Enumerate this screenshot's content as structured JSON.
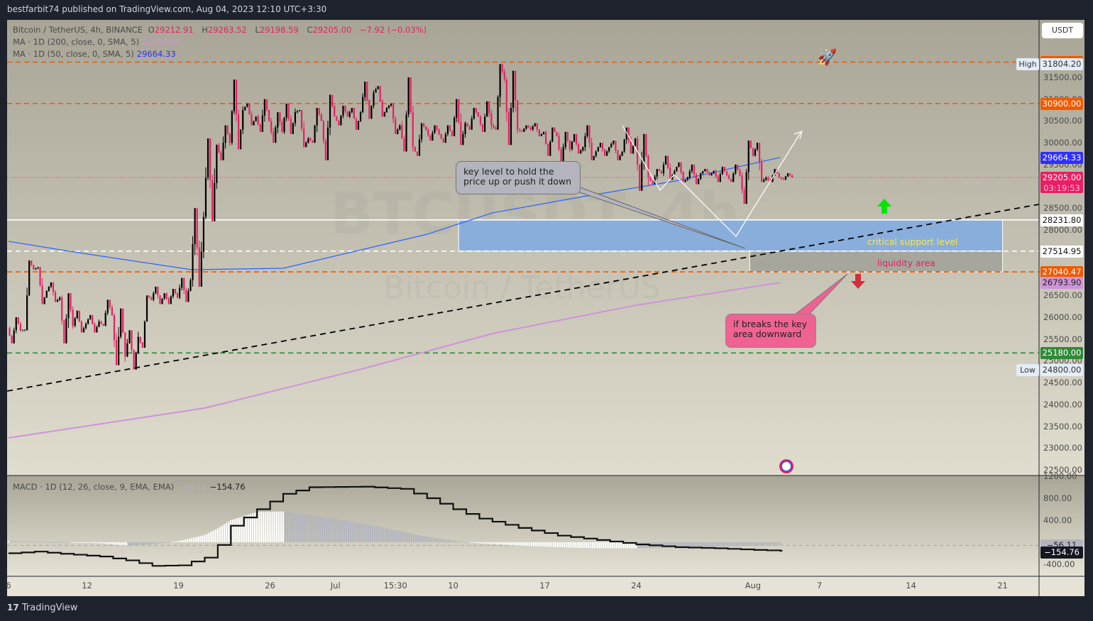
{
  "header": {
    "published": "bestfarbit74 published on TradingView.com, Aug 04, 2023 12:10 UTC+3:30"
  },
  "legend": {
    "symbol": "Bitcoin / TetherUS, 4h, BINANCE",
    "o_label": "O",
    "o": "29212.91",
    "h_label": "H",
    "h": "29263.52",
    "l_label": "L",
    "l": "29198.59",
    "c_label": "C",
    "c": "29205.00",
    "change": "−7.92 (−0.03%)",
    "ma200_label": "MA · 1D (200, close, 0, SMA, 5)",
    "ma200_value": "26793.90",
    "ma50_label": "MA · 1D (50, close, 0, SMA, 5)",
    "ma50_value": "29664.33",
    "macd_label": "MACD · 1D (12, 26, close, 9, EMA, EMA)",
    "macd_hist_value": "−56.11",
    "macd_value": "−154.76"
  },
  "watermark": {
    "line1": "BTCUSDT, 4h",
    "line2": "Bitcoin / TetherUS"
  },
  "currency": "USDT",
  "footer": {
    "brand": "TradingView"
  },
  "annotations": {
    "key_level": "key level to hold the price up or push it down",
    "breaks": "if breaks the key area downward",
    "critical": "critical support level",
    "liquidity": "liquidity area"
  },
  "colors": {
    "up": "#000000",
    "down": "#e91e63",
    "ma50": "#2962ff",
    "ma200": "#ce93d8",
    "orange": "#f05a00",
    "green": "#2e8b36",
    "zone_blue": "#8aaedc",
    "zone_grey": "#a7a69c"
  },
  "chart_data": {
    "type": "candlestick",
    "symbol": "BTCUSDT",
    "interval": "4h",
    "ylim": [
      22500,
      32000
    ],
    "price_ticks": [
      22500,
      23000,
      23500,
      24000,
      24500,
      25000,
      25500,
      26000,
      26500,
      27000,
      27500,
      28000,
      28500,
      29000,
      29500,
      30000,
      30500,
      31000,
      31500
    ],
    "time_ticks": [
      {
        "label": "6",
        "date": "2023-06-06"
      },
      {
        "label": "12",
        "date": "2023-06-12"
      },
      {
        "label": "19",
        "date": "2023-06-19"
      },
      {
        "label": "26",
        "date": "2023-06-26"
      },
      {
        "label": "Jul",
        "date": "2023-07-01"
      },
      {
        "label": "15:30",
        "date": "2023-07-05T14:00"
      },
      {
        "label": "10",
        "date": "2023-07-10"
      },
      {
        "label": "17",
        "date": "2023-07-17"
      },
      {
        "label": "24",
        "date": "2023-07-24"
      },
      {
        "label": "Aug",
        "date": "2023-08-01T22:00"
      },
      {
        "label": "7",
        "date": "2023-08-07"
      },
      {
        "label": "14",
        "date": "2023-08-14"
      },
      {
        "label": "21",
        "date": "2023-08-21"
      }
    ],
    "daily_ohlc": [
      [
        "2023-06-06",
        25750,
        26000,
        25400,
        25700
      ],
      [
        "2023-06-07",
        25700,
        27300,
        25700,
        27100
      ],
      [
        "2023-06-08",
        27100,
        27150,
        26300,
        26600
      ],
      [
        "2023-06-09",
        26600,
        26800,
        26350,
        26450
      ],
      [
        "2023-06-10",
        26450,
        26550,
        25400,
        25800
      ],
      [
        "2023-06-11",
        25800,
        26150,
        25650,
        25850
      ],
      [
        "2023-06-12",
        25850,
        26050,
        25650,
        25900
      ],
      [
        "2023-06-13",
        25900,
        26400,
        25800,
        26050
      ],
      [
        "2023-06-14",
        26050,
        26200,
        24900,
        25100
      ],
      [
        "2023-06-15",
        25100,
        25700,
        24800,
        25550
      ],
      [
        "2023-06-16",
        25550,
        26500,
        25300,
        26400
      ],
      [
        "2023-06-17",
        26400,
        26700,
        26300,
        26550
      ],
      [
        "2023-06-18",
        26550,
        26650,
        26300,
        26450
      ],
      [
        "2023-06-19",
        26450,
        26900,
        26350,
        26850
      ],
      [
        "2023-06-20",
        26850,
        28500,
        26700,
        28300
      ],
      [
        "2023-06-21",
        28300,
        30100,
        28200,
        29950
      ],
      [
        "2023-06-22",
        29950,
        30400,
        29600,
        30000
      ],
      [
        "2023-06-23",
        30000,
        31450,
        29850,
        30750
      ],
      [
        "2023-06-24",
        30750,
        30900,
        30400,
        30600
      ],
      [
        "2023-06-25",
        30600,
        31000,
        30250,
        30500
      ],
      [
        "2023-06-26",
        30500,
        30700,
        30000,
        30250
      ],
      [
        "2023-06-27",
        30250,
        30900,
        30200,
        30700
      ],
      [
        "2023-06-28",
        30700,
        30750,
        29900,
        30100
      ],
      [
        "2023-06-29",
        30100,
        30800,
        30000,
        30500
      ],
      [
        "2023-06-30",
        30500,
        31100,
        29600,
        30600
      ],
      [
        "2023-07-01",
        30600,
        30850,
        30400,
        30600
      ],
      [
        "2023-07-02",
        30600,
        30800,
        30300,
        30700
      ],
      [
        "2023-07-03",
        30700,
        31400,
        30550,
        31150
      ],
      [
        "2023-07-04",
        31150,
        31300,
        30600,
        30800
      ],
      [
        "2023-07-05",
        30800,
        30900,
        30200,
        30400
      ],
      [
        "2023-07-06",
        30400,
        31500,
        29800,
        29900
      ],
      [
        "2023-07-07",
        29900,
        30450,
        29700,
        30300
      ],
      [
        "2023-07-08",
        30300,
        30400,
        30050,
        30200
      ],
      [
        "2023-07-09",
        30200,
        30400,
        30000,
        30150
      ],
      [
        "2023-07-10",
        30150,
        31000,
        29950,
        30450
      ],
      [
        "2023-07-11",
        30450,
        30800,
        30300,
        30600
      ],
      [
        "2023-07-12",
        30600,
        30950,
        30250,
        30400
      ],
      [
        "2023-07-13",
        30400,
        31804.2,
        30300,
        31450
      ],
      [
        "2023-07-14",
        31450,
        31650,
        29950,
        30300
      ],
      [
        "2023-07-15",
        30300,
        30400,
        30250,
        30300
      ],
      [
        "2023-07-16",
        30300,
        30450,
        30150,
        30250
      ],
      [
        "2023-07-17",
        30250,
        30350,
        29700,
        30150
      ],
      [
        "2023-07-18",
        30150,
        30250,
        29550,
        29850
      ],
      [
        "2023-07-19",
        29850,
        30200,
        29750,
        29900
      ],
      [
        "2023-07-20",
        29900,
        30400,
        29600,
        29800
      ],
      [
        "2023-07-21",
        29800,
        30000,
        29700,
        29900
      ],
      [
        "2023-07-22",
        29900,
        30050,
        29600,
        29800
      ],
      [
        "2023-07-23",
        29800,
        30350,
        29750,
        30100
      ],
      [
        "2023-07-24",
        30100,
        30200,
        28900,
        29200
      ],
      [
        "2023-07-25",
        29200,
        29400,
        29050,
        29300
      ],
      [
        "2023-07-26",
        29300,
        29700,
        29150,
        29350
      ],
      [
        "2023-07-27",
        29350,
        29550,
        29100,
        29200
      ],
      [
        "2023-07-28",
        29200,
        29500,
        29050,
        29300
      ],
      [
        "2023-07-29",
        29300,
        29400,
        29250,
        29350
      ],
      [
        "2023-07-30",
        29350,
        29450,
        29100,
        29250
      ],
      [
        "2023-07-31",
        29250,
        29500,
        29100,
        29250
      ],
      [
        "2023-08-01",
        29250,
        30050,
        28600,
        29700
      ],
      [
        "2023-08-02",
        29700,
        30000,
        29100,
        29200
      ],
      [
        "2023-08-03",
        29200,
        29400,
        29100,
        29200
      ],
      [
        "2023-08-04",
        29200,
        29300,
        29150,
        29205
      ]
    ],
    "high": {
      "label": "High",
      "value": "31804.20"
    },
    "low": {
      "label": "Low",
      "value": "24800.00"
    },
    "last": {
      "value": "29205.00",
      "countdown": "03:19:53"
    },
    "ma50": [
      [
        "2023-06-06",
        27740
      ],
      [
        "2023-06-11",
        27496
      ],
      [
        "2023-06-20",
        27090
      ],
      [
        "2023-06-27",
        27122
      ],
      [
        "2023-07-08",
        27903
      ],
      [
        "2023-07-13",
        28392
      ],
      [
        "2023-07-19",
        28717
      ],
      [
        "2023-07-27",
        29124
      ],
      [
        "2023-08-04",
        29664.33
      ]
    ],
    "ma200": [
      [
        "2023-06-06",
        23232
      ],
      [
        "2023-06-21",
        23916
      ],
      [
        "2023-07-03",
        24811
      ],
      [
        "2023-07-13",
        25625
      ],
      [
        "2023-07-24",
        26276
      ],
      [
        "2023-08-04",
        26793.9
      ]
    ],
    "levels": [
      {
        "value": 31850,
        "label": "31850.00",
        "color": "#f05a00",
        "style": "dashed"
      },
      {
        "value": 30900,
        "label": "30900.00",
        "color": "#f05a00",
        "style": "dashed"
      },
      {
        "value": 28231.8,
        "label": "28231.80",
        "color": "#ffffff",
        "style": "solid"
      },
      {
        "value": 27514.95,
        "label": "27514.95",
        "color": "#ffffff",
        "style": "dashed"
      },
      {
        "value": 27040.47,
        "label": "27040.47",
        "color": "#f05a00",
        "style": "dashed"
      },
      {
        "value": 25180,
        "label": "25180.00",
        "color": "#2e8b36",
        "style": "dashed"
      }
    ],
    "ma_badges": [
      {
        "value": 29664.33,
        "label": "29664.33",
        "color": "#2f2fff"
      },
      {
        "value": 26793.9,
        "label": "26793.90",
        "color": "#ce93d8"
      }
    ],
    "trendline": [
      [
        "2023-06-15",
        24800
      ],
      [
        "2023-08-24",
        28600
      ]
    ],
    "zones": [
      {
        "name": "critical",
        "from": "2023-07-10T10:00",
        "to": "2023-08-21",
        "top": 28231.8,
        "bottom": 27514.95
      },
      {
        "name": "liquidity",
        "from": "2023-08-01T16:00",
        "to": "2023-08-21",
        "top": 27514.95,
        "bottom": 27040.47
      }
    ],
    "macd": {
      "ticks": [
        1200,
        800,
        400,
        -400
      ],
      "points": [
        [
          "2023-06-06",
          -200,
          20
        ],
        [
          "2023-06-08",
          -170,
          10
        ],
        [
          "2023-06-10",
          -210,
          5
        ],
        [
          "2023-06-13",
          -260,
          -20
        ],
        [
          "2023-06-15",
          -330,
          -60
        ],
        [
          "2023-06-17",
          -430,
          -40
        ],
        [
          "2023-06-19",
          -420,
          20
        ],
        [
          "2023-06-21",
          -280,
          130
        ],
        [
          "2023-06-22",
          -50,
          250
        ],
        [
          "2023-06-23",
          300,
          400
        ],
        [
          "2023-06-25",
          600,
          550
        ],
        [
          "2023-06-27",
          880,
          560
        ],
        [
          "2023-06-29",
          1000,
          500
        ],
        [
          "2023-07-03",
          1010,
          350
        ],
        [
          "2023-07-06",
          970,
          200
        ],
        [
          "2023-07-08",
          800,
          100
        ],
        [
          "2023-07-10",
          600,
          30
        ],
        [
          "2023-07-12",
          430,
          -20
        ],
        [
          "2023-07-15",
          260,
          -60
        ],
        [
          "2023-07-18",
          120,
          -90
        ],
        [
          "2023-07-21",
          40,
          -110
        ],
        [
          "2023-07-24",
          -40,
          -110
        ],
        [
          "2023-07-27",
          -90,
          -100
        ],
        [
          "2023-07-30",
          -110,
          -80
        ],
        [
          "2023-08-02",
          -140,
          -60
        ],
        [
          "2023-08-04",
          -154.76,
          -56.11
        ]
      ]
    }
  }
}
